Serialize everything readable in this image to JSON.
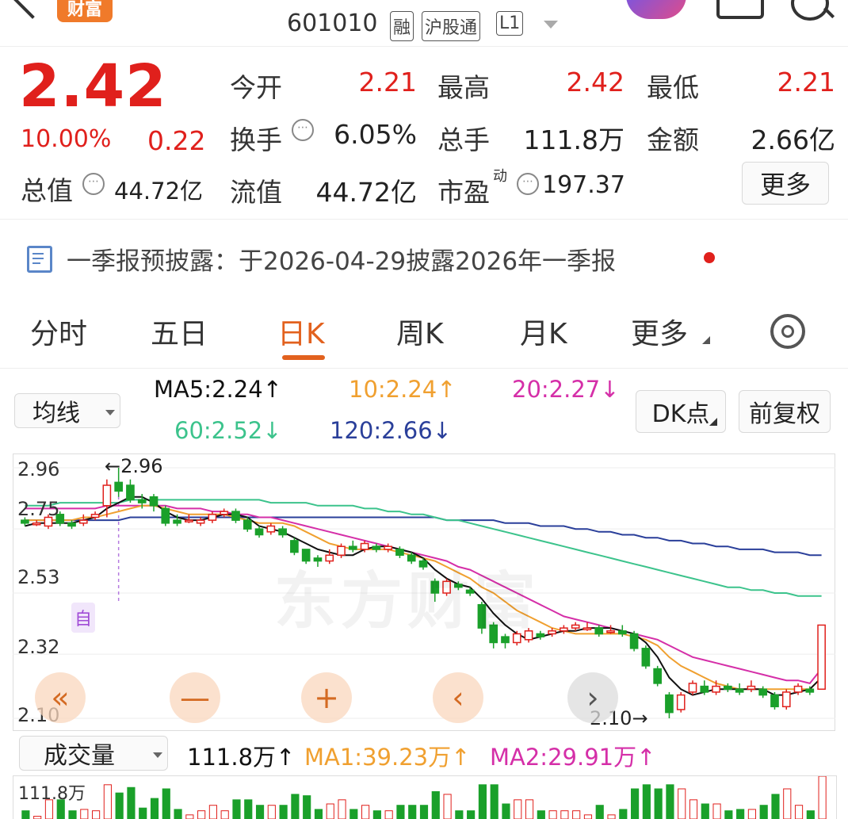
{
  "header": {
    "back_icon": "chevron-left-icon",
    "logo_text": "财富",
    "code": "601010",
    "badges": [
      "融",
      "沪股通",
      "L1"
    ],
    "dropdown_icon": "caret-down-icon"
  },
  "quote": {
    "price": "2.42",
    "change_pct": "10.00%",
    "change_amt": "0.22",
    "stats": [
      {
        "label": "今开",
        "value": "2.21",
        "red": true
      },
      {
        "label": "最高",
        "value": "2.42",
        "red": true
      },
      {
        "label": "最低",
        "value": "2.21",
        "red": true
      },
      {
        "label": "换手",
        "value": "6.05%",
        "red": false
      },
      {
        "label": "总手",
        "value": "111.8万",
        "red": false
      },
      {
        "label": "金额",
        "value": "2.66亿",
        "red": false
      },
      {
        "label": "流值",
        "value": "44.72亿",
        "red": false
      }
    ],
    "total_value_label": "总值",
    "total_value": "44.72亿",
    "pe_label": "市盈",
    "pe_sup": "动",
    "pe_value": "197.37",
    "more_button": "更多"
  },
  "notice": {
    "text": "一季报预披露：于2026-04-29披露2026年一季报"
  },
  "tabs": [
    "分时",
    "五日",
    "日K",
    "周K",
    "月K",
    "更多"
  ],
  "active_tab": "日K",
  "ma_bar": {
    "selector": "均线",
    "ma5": "MA5:2.24↑",
    "ma10": "10:2.24↑",
    "ma20": "20:2.27↓",
    "ma60": "60:2.52↓",
    "ma120": "120:2.66↓",
    "dk_button": "DK点",
    "fq_button": "前复权",
    "colors": {
      "ma5": "#111111",
      "ma10": "#f0a030",
      "ma20": "#d52fa8",
      "ma60": "#3cc38c",
      "ma120": "#2a3f9a"
    }
  },
  "chart": {
    "y_ticks": [
      "2.96",
      "2.75",
      "2.53",
      "2.32",
      "2.10"
    ],
    "high_marker": "←2.96",
    "low_marker": "2.10→",
    "self_marker": "自",
    "watermark": "东方财富",
    "nav_icons": [
      "double-left-icon",
      "minus-icon",
      "plus-icon",
      "chevron-left-icon",
      "chevron-right-icon"
    ],
    "nav_glyphs": [
      "«",
      "—",
      "+",
      "‹",
      "›"
    ]
  },
  "volume_bar": {
    "selector": "成交量",
    "vol": "111.8万↑",
    "ma1": "MA1:39.23万↑",
    "ma2": "MA2:29.91万↑",
    "top_label": "111.8万"
  },
  "chart_data": {
    "type": "candlestick",
    "ylim": [
      2.1,
      2.96
    ],
    "y_ticks": [
      2.96,
      2.75,
      2.53,
      2.32,
      2.1
    ],
    "bars": [
      {
        "o": 2.78,
        "c": 2.77,
        "h": 2.79,
        "l": 2.76
      },
      {
        "o": 2.77,
        "c": 2.77,
        "h": 2.78,
        "l": 2.76
      },
      {
        "o": 2.76,
        "c": 2.79,
        "h": 2.8,
        "l": 2.75
      },
      {
        "o": 2.8,
        "c": 2.77,
        "h": 2.81,
        "l": 2.76
      },
      {
        "o": 2.77,
        "c": 2.76,
        "h": 2.78,
        "l": 2.75
      },
      {
        "o": 2.77,
        "c": 2.78,
        "h": 2.8,
        "l": 2.76
      },
      {
        "o": 2.79,
        "c": 2.8,
        "h": 2.81,
        "l": 2.78
      },
      {
        "o": 2.83,
        "c": 2.9,
        "h": 2.92,
        "l": 2.79
      },
      {
        "o": 2.91,
        "c": 2.88,
        "h": 2.96,
        "l": 2.86
      },
      {
        "o": 2.9,
        "c": 2.85,
        "h": 2.92,
        "l": 2.84
      },
      {
        "o": 2.85,
        "c": 2.84,
        "h": 2.87,
        "l": 2.82
      },
      {
        "o": 2.86,
        "c": 2.83,
        "h": 2.87,
        "l": 2.81
      },
      {
        "o": 2.82,
        "c": 2.77,
        "h": 2.83,
        "l": 2.76
      },
      {
        "o": 2.78,
        "c": 2.77,
        "h": 2.8,
        "l": 2.76
      },
      {
        "o": 2.78,
        "c": 2.78,
        "h": 2.8,
        "l": 2.77
      },
      {
        "o": 2.77,
        "c": 2.78,
        "h": 2.79,
        "l": 2.76
      },
      {
        "o": 2.78,
        "c": 2.8,
        "h": 2.81,
        "l": 2.77
      },
      {
        "o": 2.8,
        "c": 2.81,
        "h": 2.82,
        "l": 2.79
      },
      {
        "o": 2.81,
        "c": 2.78,
        "h": 2.82,
        "l": 2.77
      },
      {
        "o": 2.78,
        "c": 2.75,
        "h": 2.79,
        "l": 2.74
      },
      {
        "o": 2.75,
        "c": 2.73,
        "h": 2.76,
        "l": 2.72
      },
      {
        "o": 2.74,
        "c": 2.76,
        "h": 2.77,
        "l": 2.73
      },
      {
        "o": 2.75,
        "c": 2.73,
        "h": 2.76,
        "l": 2.72
      },
      {
        "o": 2.71,
        "c": 2.67,
        "h": 2.72,
        "l": 2.66
      },
      {
        "o": 2.68,
        "c": 2.64,
        "h": 2.68,
        "l": 2.63
      },
      {
        "o": 2.65,
        "c": 2.64,
        "h": 2.66,
        "l": 2.62
      },
      {
        "o": 2.64,
        "c": 2.66,
        "h": 2.68,
        "l": 2.63
      },
      {
        "o": 2.66,
        "c": 2.69,
        "h": 2.7,
        "l": 2.65
      },
      {
        "o": 2.69,
        "c": 2.68,
        "h": 2.71,
        "l": 2.67
      },
      {
        "o": 2.68,
        "c": 2.7,
        "h": 2.71,
        "l": 2.67
      },
      {
        "o": 2.69,
        "c": 2.68,
        "h": 2.7,
        "l": 2.67
      },
      {
        "o": 2.68,
        "c": 2.69,
        "h": 2.7,
        "l": 2.67
      },
      {
        "o": 2.68,
        "c": 2.66,
        "h": 2.69,
        "l": 2.65
      },
      {
        "o": 2.66,
        "c": 2.64,
        "h": 2.67,
        "l": 2.63
      },
      {
        "o": 2.64,
        "c": 2.62,
        "h": 2.65,
        "l": 2.61
      },
      {
        "o": 2.57,
        "c": 2.53,
        "h": 2.58,
        "l": 2.5
      },
      {
        "o": 2.53,
        "c": 2.57,
        "h": 2.58,
        "l": 2.52
      },
      {
        "o": 2.56,
        "c": 2.55,
        "h": 2.57,
        "l": 2.54
      },
      {
        "o": 2.54,
        "c": 2.53,
        "h": 2.55,
        "l": 2.52
      },
      {
        "o": 2.49,
        "c": 2.41,
        "h": 2.5,
        "l": 2.39
      },
      {
        "o": 2.42,
        "c": 2.36,
        "h": 2.43,
        "l": 2.34
      },
      {
        "o": 2.38,
        "c": 2.36,
        "h": 2.39,
        "l": 2.34
      },
      {
        "o": 2.36,
        "c": 2.39,
        "h": 2.4,
        "l": 2.35
      },
      {
        "o": 2.37,
        "c": 2.4,
        "h": 2.41,
        "l": 2.36
      },
      {
        "o": 2.39,
        "c": 2.38,
        "h": 2.4,
        "l": 2.37
      },
      {
        "o": 2.39,
        "c": 2.4,
        "h": 2.41,
        "l": 2.38
      },
      {
        "o": 2.4,
        "c": 2.41,
        "h": 2.42,
        "l": 2.39
      },
      {
        "o": 2.41,
        "c": 2.42,
        "h": 2.43,
        "l": 2.4
      },
      {
        "o": 2.41,
        "c": 2.41,
        "h": 2.43,
        "l": 2.4
      },
      {
        "o": 2.41,
        "c": 2.39,
        "h": 2.42,
        "l": 2.38
      },
      {
        "o": 2.4,
        "c": 2.4,
        "h": 2.42,
        "l": 2.39
      },
      {
        "o": 2.4,
        "c": 2.39,
        "h": 2.42,
        "l": 2.38
      },
      {
        "o": 2.39,
        "c": 2.34,
        "h": 2.4,
        "l": 2.33
      },
      {
        "o": 2.34,
        "c": 2.28,
        "h": 2.35,
        "l": 2.27
      },
      {
        "o": 2.27,
        "c": 2.22,
        "h": 2.28,
        "l": 2.21
      },
      {
        "o": 2.18,
        "c": 2.12,
        "h": 2.19,
        "l": 2.1
      },
      {
        "o": 2.13,
        "c": 2.18,
        "h": 2.19,
        "l": 2.12
      },
      {
        "o": 2.19,
        "c": 2.22,
        "h": 2.23,
        "l": 2.18
      },
      {
        "o": 2.21,
        "c": 2.19,
        "h": 2.23,
        "l": 2.18
      },
      {
        "o": 2.19,
        "c": 2.21,
        "h": 2.23,
        "l": 2.18
      },
      {
        "o": 2.21,
        "c": 2.2,
        "h": 2.22,
        "l": 2.19
      },
      {
        "o": 2.2,
        "c": 2.19,
        "h": 2.22,
        "l": 2.18
      },
      {
        "o": 2.2,
        "c": 2.21,
        "h": 2.23,
        "l": 2.19
      },
      {
        "o": 2.2,
        "c": 2.18,
        "h": 2.21,
        "l": 2.17
      },
      {
        "o": 2.18,
        "c": 2.14,
        "h": 2.19,
        "l": 2.13
      },
      {
        "o": 2.14,
        "c": 2.19,
        "h": 2.2,
        "l": 2.13
      },
      {
        "o": 2.19,
        "c": 2.21,
        "h": 2.22,
        "l": 2.18
      },
      {
        "o": 2.2,
        "c": 2.19,
        "h": 2.21,
        "l": 2.18
      },
      {
        "o": 2.2,
        "c": 2.42,
        "h": 2.42,
        "l": 2.2
      }
    ],
    "ma5": [
      2.76,
      2.77,
      2.77,
      2.77,
      2.77,
      2.78,
      2.79,
      2.82,
      2.84,
      2.86,
      2.86,
      2.84,
      2.81,
      2.79,
      2.78,
      2.78,
      2.79,
      2.8,
      2.8,
      2.79,
      2.76,
      2.75,
      2.74,
      2.72,
      2.7,
      2.68,
      2.67,
      2.66,
      2.66,
      2.68,
      2.69,
      2.69,
      2.68,
      2.67,
      2.65,
      2.61,
      2.58,
      2.56,
      2.55,
      2.51,
      2.46,
      2.42,
      2.39,
      2.37,
      2.38,
      2.39,
      2.4,
      2.4,
      2.41,
      2.41,
      2.41,
      2.4,
      2.39,
      2.36,
      2.31,
      2.24,
      2.2,
      2.18,
      2.19,
      2.2,
      2.2,
      2.2,
      2.2,
      2.2,
      2.18,
      2.18,
      2.19,
      2.2,
      2.24
    ],
    "ma10": [
      2.78,
      2.78,
      2.78,
      2.78,
      2.78,
      2.79,
      2.79,
      2.8,
      2.81,
      2.82,
      2.83,
      2.83,
      2.82,
      2.81,
      2.8,
      2.8,
      2.8,
      2.8,
      2.79,
      2.78,
      2.77,
      2.77,
      2.77,
      2.76,
      2.74,
      2.72,
      2.7,
      2.69,
      2.68,
      2.68,
      2.68,
      2.68,
      2.67,
      2.66,
      2.65,
      2.64,
      2.62,
      2.6,
      2.58,
      2.55,
      2.53,
      2.5,
      2.47,
      2.45,
      2.43,
      2.41,
      2.4,
      2.39,
      2.39,
      2.39,
      2.39,
      2.39,
      2.38,
      2.37,
      2.35,
      2.31,
      2.28,
      2.26,
      2.24,
      2.22,
      2.21,
      2.2,
      2.2,
      2.2,
      2.2,
      2.2,
      2.2,
      2.2,
      2.24
    ],
    "ma20": [
      2.82,
      2.82,
      2.82,
      2.82,
      2.82,
      2.82,
      2.82,
      2.83,
      2.83,
      2.83,
      2.83,
      2.83,
      2.83,
      2.82,
      2.82,
      2.82,
      2.81,
      2.81,
      2.8,
      2.8,
      2.79,
      2.79,
      2.78,
      2.77,
      2.76,
      2.75,
      2.74,
      2.73,
      2.72,
      2.71,
      2.7,
      2.69,
      2.68,
      2.67,
      2.66,
      2.65,
      2.64,
      2.62,
      2.61,
      2.59,
      2.57,
      2.55,
      2.53,
      2.51,
      2.49,
      2.47,
      2.45,
      2.44,
      2.43,
      2.42,
      2.41,
      2.4,
      2.39,
      2.38,
      2.37,
      2.35,
      2.33,
      2.31,
      2.3,
      2.29,
      2.28,
      2.27,
      2.26,
      2.25,
      2.24,
      2.23,
      2.23,
      2.22,
      2.27
    ],
    "ma60": [
      2.83,
      2.83,
      2.83,
      2.84,
      2.84,
      2.84,
      2.84,
      2.84,
      2.84,
      2.85,
      2.85,
      2.85,
      2.85,
      2.85,
      2.85,
      2.85,
      2.85,
      2.85,
      2.85,
      2.85,
      2.85,
      2.84,
      2.84,
      2.84,
      2.84,
      2.83,
      2.83,
      2.83,
      2.83,
      2.82,
      2.82,
      2.81,
      2.81,
      2.8,
      2.8,
      2.79,
      2.78,
      2.78,
      2.77,
      2.76,
      2.75,
      2.74,
      2.73,
      2.72,
      2.71,
      2.7,
      2.69,
      2.68,
      2.67,
      2.66,
      2.65,
      2.64,
      2.63,
      2.62,
      2.61,
      2.6,
      2.59,
      2.58,
      2.57,
      2.56,
      2.55,
      2.55,
      2.54,
      2.54,
      2.53,
      2.53,
      2.52,
      2.52,
      2.52
    ],
    "ma120": [
      2.78,
      2.78,
      2.78,
      2.78,
      2.78,
      2.78,
      2.78,
      2.78,
      2.78,
      2.79,
      2.79,
      2.79,
      2.79,
      2.79,
      2.79,
      2.79,
      2.79,
      2.79,
      2.79,
      2.79,
      2.79,
      2.79,
      2.79,
      2.79,
      2.79,
      2.79,
      2.79,
      2.79,
      2.79,
      2.79,
      2.79,
      2.79,
      2.79,
      2.79,
      2.79,
      2.79,
      2.78,
      2.78,
      2.78,
      2.78,
      2.78,
      2.77,
      2.77,
      2.77,
      2.76,
      2.76,
      2.76,
      2.75,
      2.75,
      2.74,
      2.74,
      2.73,
      2.73,
      2.72,
      2.72,
      2.71,
      2.71,
      2.7,
      2.7,
      2.69,
      2.69,
      2.68,
      2.68,
      2.68,
      2.67,
      2.67,
      2.67,
      2.66,
      2.66
    ]
  }
}
